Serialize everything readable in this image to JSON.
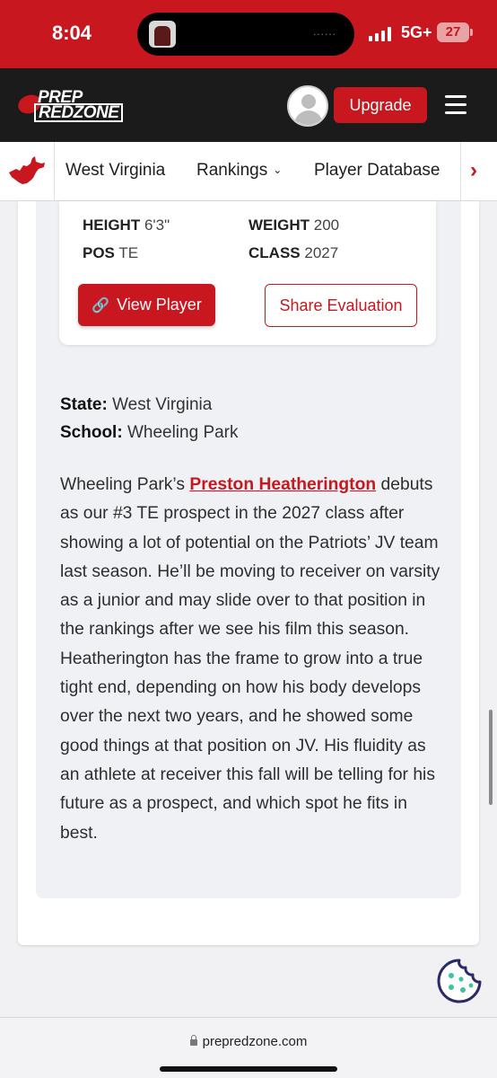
{
  "status_bar": {
    "time": "8:04",
    "network": "5G+",
    "battery": "27",
    "island_dots": "......"
  },
  "header": {
    "logo_line1": "PREP",
    "logo_line2": "REDZONE",
    "upgrade_label": "Upgrade"
  },
  "subnav": {
    "state": "West Virginia",
    "rankings": "Rankings",
    "rankings_chevron": "⌄",
    "database": "Player Database",
    "more_arrow": "›"
  },
  "player_card": {
    "height_label": "HEIGHT",
    "height_value": "6'3\"",
    "weight_label": "WEIGHT",
    "weight_value": "200",
    "pos_label": "POS",
    "pos_value": "TE",
    "class_label": "CLASS",
    "class_value": "2027",
    "view_label": "View Player",
    "share_label": "Share Evaluation"
  },
  "meta": {
    "state_label": "State:",
    "state_value": "West Virginia",
    "school_label": "School:",
    "school_value": "Wheeling Park"
  },
  "article": {
    "intro": "Wheeling Park’s ",
    "player_link": "Preston Heatherington",
    "body": " debuts as our #3 TE prospect in the 2027 class after showing a lot of potential on the Patriots’ JV team last season. He’ll be moving to receiver on varsity as a junior and may slide over to that position in the rankings after we see his film this season. Heatherington has the frame to grow into a true tight end, depending on how his body develops over the next two years, and he showed some good things at that position on JV. His fluidity as an athlete at receiver this fall will be telling for his future as a prospect, and which spot he fits in best."
  },
  "browser": {
    "url": "prepredzone.com"
  },
  "colors": {
    "brand_red": "#c8171e",
    "header_dark": "#1b1b1b",
    "cookie_teal": "#3ec2a0",
    "cookie_navy": "#2a2a6a"
  }
}
